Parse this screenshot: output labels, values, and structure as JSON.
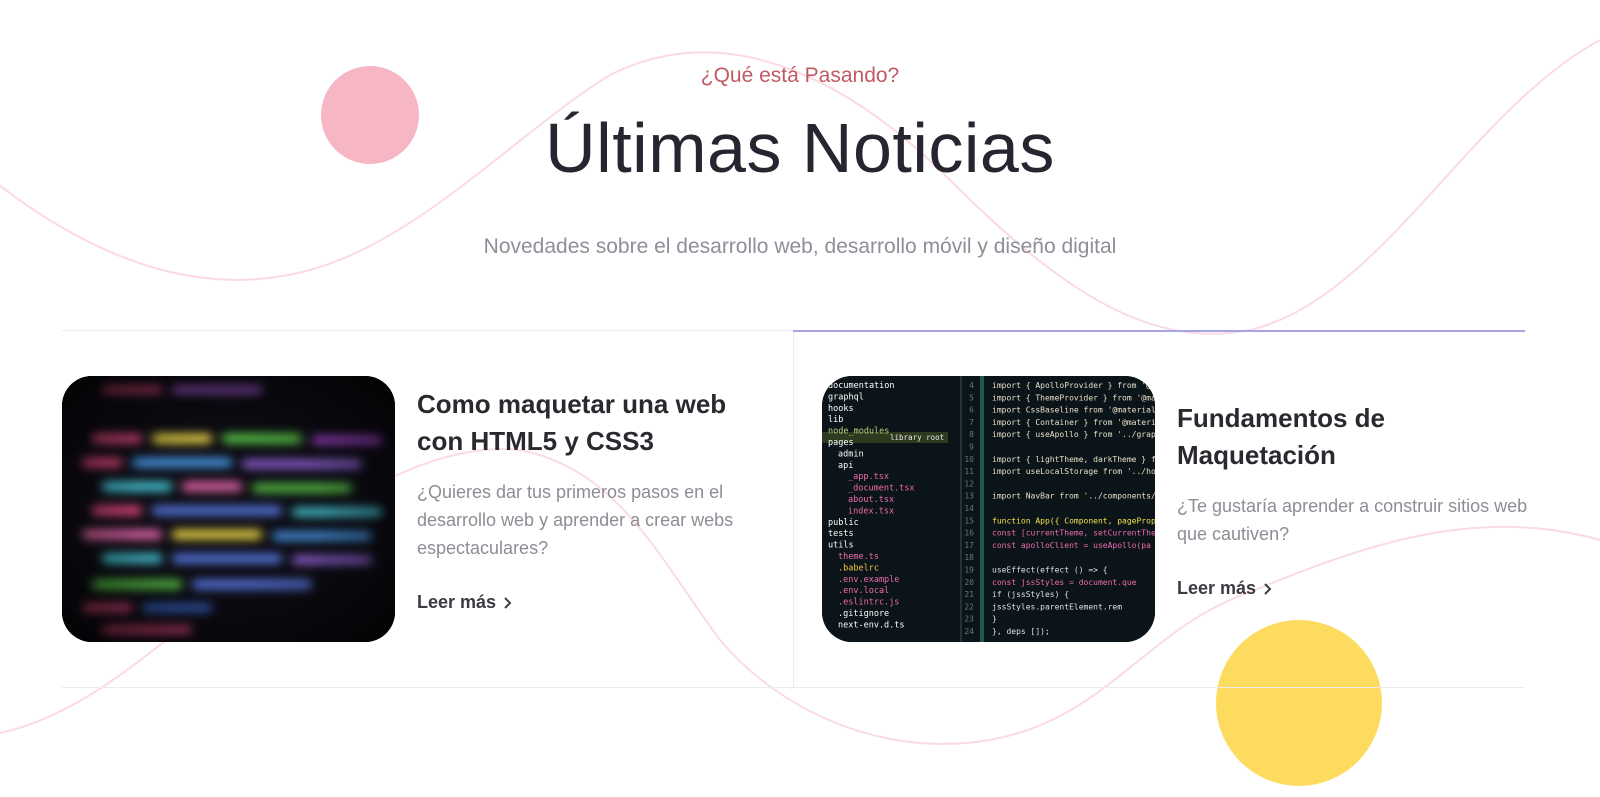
{
  "section": {
    "eyebrow": "¿Qué está Pasando?",
    "title": "Últimas Noticias",
    "subtitle": "Novedades sobre el desarrollo web, desarrollo móvil y diseño digital"
  },
  "colors": {
    "eyebrow": "#c15a63",
    "title": "#27252f",
    "accent_line": "#a9a4e3",
    "pink_circle": "#f7b6c4",
    "yellow_circle": "#fddb5f"
  },
  "cards": [
    {
      "title": "Como maquetar una web con HTML5 y CSS3",
      "text": "¿Quieres dar tus primeros pasos en el desarrollo web y aprender a crear webs espectaculares?",
      "link": "Leer más",
      "image": "blurred-code-screen"
    },
    {
      "title": "Fundamentos de Maquetación",
      "text": "¿Te gustaría aprender a construir sitios web que cautiven?",
      "link": "Leer más",
      "image": "code-editor-screen",
      "code": {
        "tree": [
          "documentation",
          "graphql",
          "hooks",
          "lib",
          "node_modules",
          "pages",
          "admin",
          "api",
          "_app.tsx",
          "_document.tsx",
          "about.tsx",
          "index.tsx",
          "public",
          "tests",
          "utils",
          "theme.ts",
          ".babelrc",
          ".env.example",
          ".env.local",
          ".eslintrc.js",
          ".gitignore",
          "next-env.d.ts"
        ],
        "badge": "library root",
        "line_numbers": [
          "4",
          "5",
          "6",
          "7",
          "8",
          "9",
          "10",
          "11",
          "12",
          "13",
          "14",
          "15",
          "16",
          "17",
          "18",
          "19",
          "20",
          "21",
          "22",
          "23",
          "24"
        ],
        "lines": [
          "import { ApolloProvider } from '@apollo/c",
          "import { ThemeProvider } from '@material-u",
          "import CssBaseline from '@material-ui/core",
          "import { Container } from '@material-ui/co",
          "import { useApollo } from '../graphql/cli",
          "",
          "import { lightTheme, darkTheme } from '..",
          "import useLocalStorage from '../hooks/us",
          "",
          "import NavBar from '../components/NavB",
          "",
          "function App({ Component, pageProps }",
          "  const [currentTheme, setCurrentThe",
          "  const apolloClient = useApollo(pa",
          "",
          "  useEffect(effect () => {",
          "    const jssStyles = document.que",
          "    if (jssStyles) {",
          "      jssStyles.parentElement.rem",
          "    }",
          "  }, deps []);"
        ]
      }
    }
  ]
}
